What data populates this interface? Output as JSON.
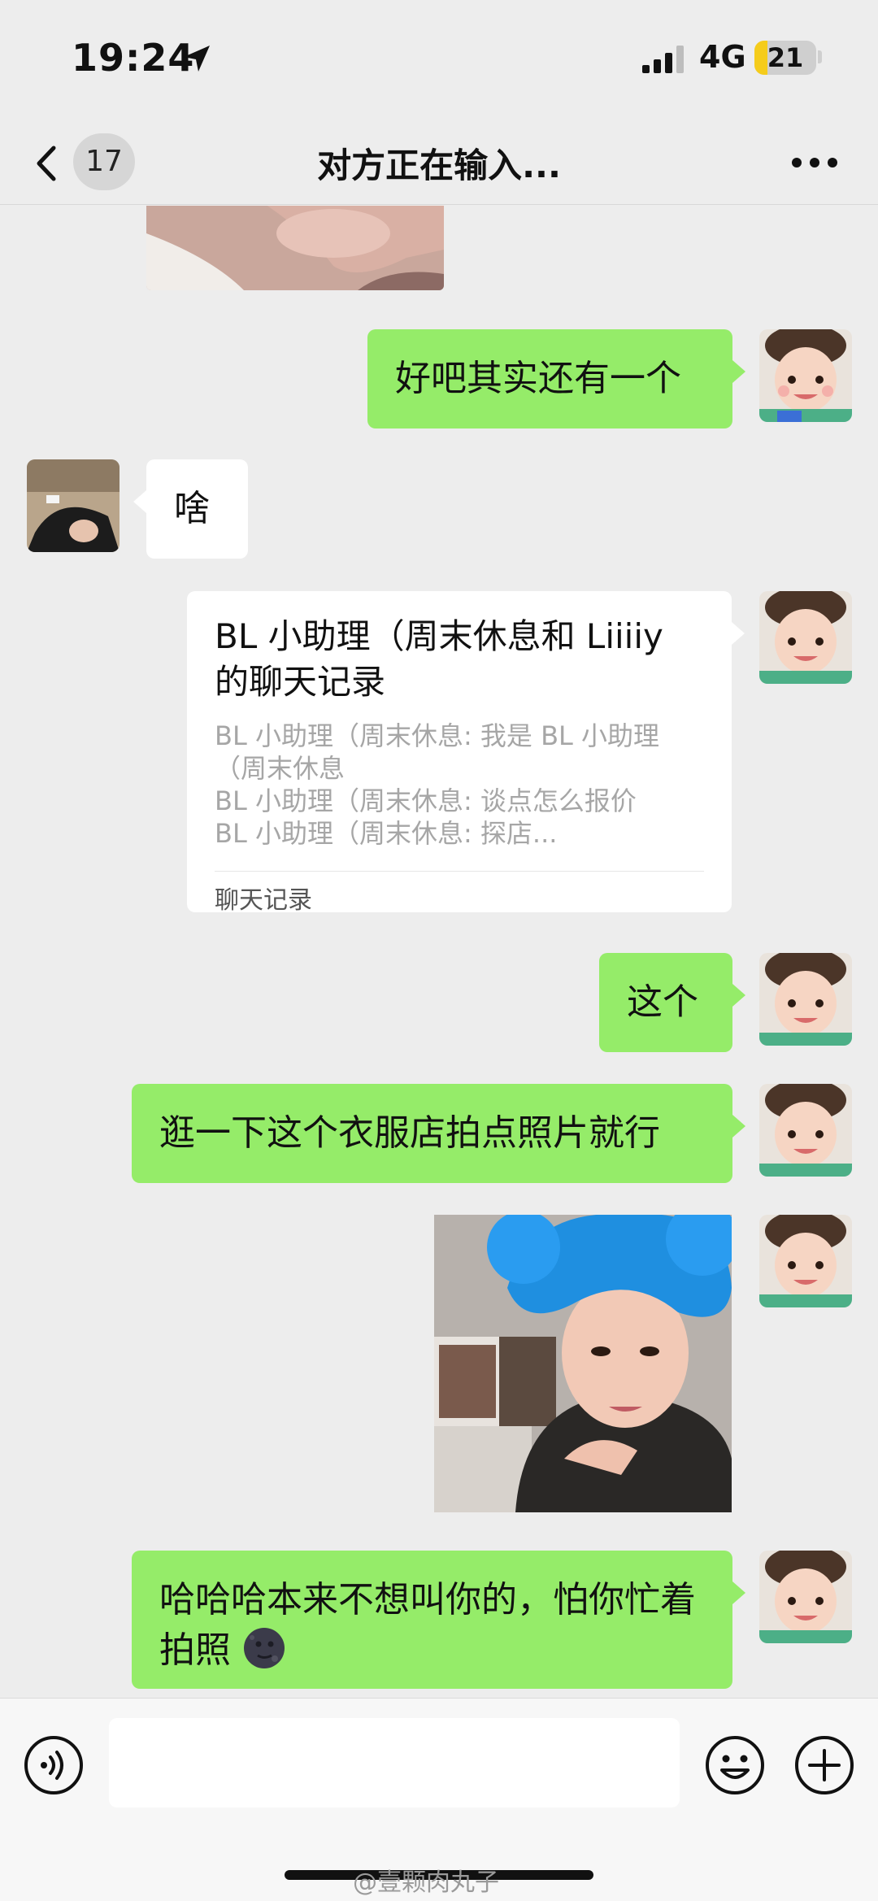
{
  "status_bar": {
    "time": "19:24",
    "network": "4G",
    "battery_level": "21",
    "battery_fraction": 0.21
  },
  "nav": {
    "unread_count": "17",
    "title": "对方正在输入..."
  },
  "messages": [
    {
      "id": "m1",
      "from": "me",
      "type": "text",
      "text": "好吧其实还有一个"
    },
    {
      "id": "m2",
      "from": "other",
      "type": "text",
      "text": "啥"
    },
    {
      "id": "m3",
      "from": "me",
      "type": "chat-record-card",
      "title": "BL 小助理（周末休息和 Liiiiy 的聊天记录",
      "lines": [
        "BL 小助理（周末休息: 我是 BL 小助理（周末休息",
        "BL 小助理（周末休息: 谈点怎么报价",
        "BL 小助理（周末休息: 探店..."
      ],
      "footer": "聊天记录"
    },
    {
      "id": "m4",
      "from": "me",
      "type": "text",
      "text": "这个"
    },
    {
      "id": "m5",
      "from": "me",
      "type": "text",
      "text": "逛一下这个衣服店拍点照片就行"
    },
    {
      "id": "m6",
      "from": "me",
      "type": "image"
    },
    {
      "id": "m7",
      "from": "me",
      "type": "text",
      "text": "哈哈哈本来不想叫你的，怕你忙着拍照",
      "emoji": "new-moon-face"
    }
  ],
  "input_bar": {
    "placeholder": "",
    "value": ""
  },
  "watermark": "@壹颗肉丸子",
  "colors": {
    "background": "#ededed",
    "my_bubble": "#95ec69",
    "other_bubble": "#ffffff",
    "battery_accent": "#f5cc1b"
  },
  "icons": [
    "location-arrow-icon",
    "signal-icon",
    "battery-icon",
    "back-chevron-icon",
    "more-dots-icon",
    "voice-icon",
    "emoji-icon",
    "plus-icon"
  ]
}
